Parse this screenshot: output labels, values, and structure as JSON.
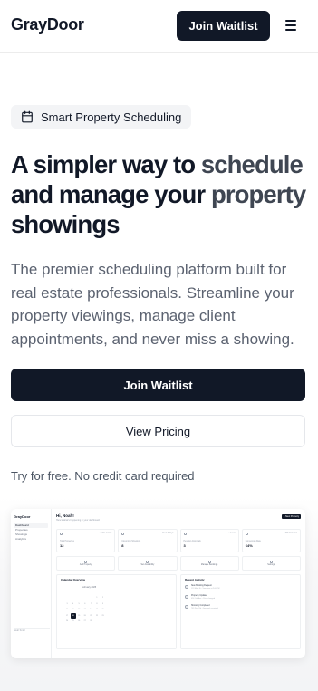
{
  "header": {
    "logo": "GrayDoor",
    "join_label": "Join Waitlist",
    "menu_icon": "hamburger-menu-icon"
  },
  "hero": {
    "badge_icon": "calendar-icon",
    "badge_label": "Smart Property Scheduling",
    "headline_part1": "A simpler way to ",
    "headline_part2": "schedule",
    "headline_part3": " and manage your ",
    "headline_part4": "property",
    "headline_part5": " showings",
    "description": "The premier scheduling platform built for real estate professionals. Streamline your property viewings, manage client appointments, and never miss a showing.",
    "join_label": "Join Waitlist",
    "pricing_label": "View Pricing",
    "note": "Try for free. No credit card required"
  },
  "preview": {
    "logo": "GrayDoor",
    "nav": [
      "Dashboard",
      "Properties",
      "Showings",
      "Analytics"
    ],
    "greeting": "Hi, Noah!",
    "subtitle": "Here's what's happening in your dashboard",
    "new_button": "+ New Property",
    "stats": [
      {
        "label": "Total Properties",
        "value": "12",
        "tag": "+2 this month"
      },
      {
        "label": "Upcoming Showings",
        "value": "8",
        "tag": "Next 7 days"
      },
      {
        "label": "Pending Approvals",
        "value": "3",
        "tag": "+1 new"
      },
      {
        "label": "Conversion Rate",
        "value": "64%",
        "tag": "+5% from last"
      }
    ],
    "actions": [
      "Add Property",
      "Set Availability",
      "Manage Bookings",
      "Settings"
    ],
    "calendar_title": "Calendar Overview",
    "calendar_month": "February 2025",
    "calendar_days": [
      "",
      "",
      "",
      "",
      "",
      "1",
      "2",
      "3",
      "4",
      "5",
      "6",
      "7",
      "8",
      "9",
      "10",
      "11",
      "12",
      "13",
      "14",
      "15",
      "16",
      "17",
      "18",
      "19",
      "20",
      "21",
      "22",
      "23",
      "24",
      "25",
      "26",
      "27",
      "28",
      "",
      ""
    ],
    "calendar_selected": "18",
    "activity_title": "Recent Activity",
    "activity": [
      {
        "title": "New Booking Request",
        "detail": "123 Main St - Tomorrow at 2:00 PM"
      },
      {
        "title": "Property Updated",
        "detail": "456 Oak Ave - Price changed"
      },
      {
        "title": "Showing Completed",
        "detail": "789 Pine Rd - Feedback received"
      }
    ],
    "user": "Noah Smith"
  }
}
